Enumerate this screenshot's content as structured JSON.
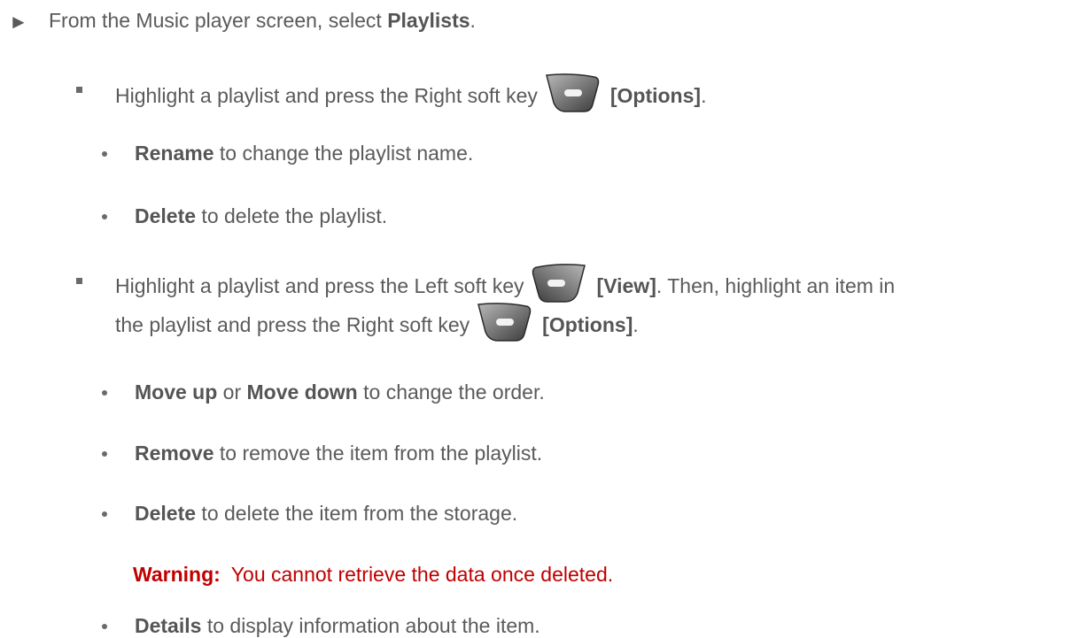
{
  "step": {
    "text_before": "From the Music player screen, select ",
    "bold": "Playlists",
    "text_after": "."
  },
  "bullet1": {
    "text": "Highlight a playlist and press the Right soft key",
    "key_label": "[Options]",
    "end": "."
  },
  "sub1": [
    {
      "bold": "Rename",
      "text": " to change the playlist name."
    },
    {
      "bold": "Delete",
      "text": " to delete the playlist."
    }
  ],
  "bullet2": {
    "text": "Highlight a playlist and press the Left soft key",
    "key_label": "[View]",
    "text_after": ". Then, highlight an item in",
    "line2_text": "the playlist and press the Right soft key",
    "key2_label": "[Options]",
    "end": "."
  },
  "sub2": {
    "move_up": "Move up",
    "or": " or ",
    "move_down": "Move down",
    "move_text": " to change the order.",
    "remove": "Remove",
    "remove_text": " to remove the item from the playlist.",
    "delete": "Delete",
    "delete_text": " to delete the item from the storage.",
    "details": "Details",
    "details_text": " to display information about the item."
  },
  "warning": {
    "label": "Warning:",
    "text": "You cannot retrieve the data once deleted."
  },
  "colors": {
    "text": "#5a5a5a",
    "warning": "#c00000"
  }
}
